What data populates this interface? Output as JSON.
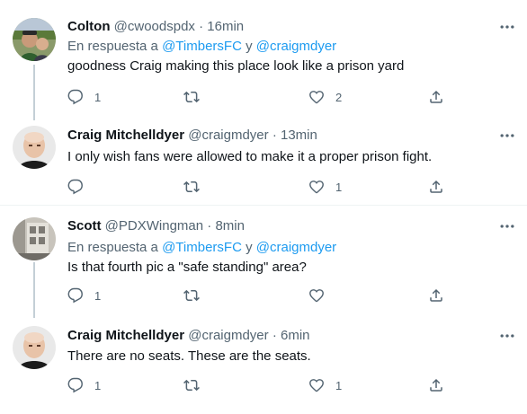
{
  "tweets": [
    {
      "name": "Colton",
      "handle": "@cwoodspdx",
      "dot": "·",
      "time": "16min",
      "reply_prefix": "En respuesta a",
      "mention1": "@TimbersFC",
      "reply_and": "y",
      "mention2": "@craigmdyer",
      "text": "goodness Craig making this place look like a prison yard",
      "reply_count": "1",
      "retweet_count": "",
      "like_count": "2",
      "avatar": "photo-person-outdoors"
    },
    {
      "name": "Craig Mitchelldyer",
      "handle": "@craigmdyer",
      "dot": "·",
      "time": "13min",
      "text": "I only wish fans were allowed to make it a proper prison fight.",
      "reply_count": "",
      "retweet_count": "",
      "like_count": "1",
      "avatar": "photo-bald-man"
    },
    {
      "name": "Scott",
      "handle": "@PDXWingman",
      "dot": "·",
      "time": "8min",
      "reply_prefix": "En respuesta a",
      "mention1": "@TimbersFC",
      "reply_and": "y",
      "mention2": "@craigmdyer",
      "text": "Is that fourth pic a \"safe standing\" area?",
      "reply_count": "1",
      "retweet_count": "",
      "like_count": "",
      "avatar": "photo-building"
    },
    {
      "name": "Craig Mitchelldyer",
      "handle": "@craigmdyer",
      "dot": "·",
      "time": "6min",
      "text": "There are no seats. These are the seats.",
      "reply_count": "1",
      "retweet_count": "",
      "like_count": "1",
      "avatar": "photo-bald-man"
    }
  ],
  "icons": {
    "reply": "reply-icon",
    "retweet": "retweet-icon",
    "like": "heart-icon",
    "share": "share-icon",
    "more": "more-icon"
  },
  "colors": {
    "text": "#0f1419",
    "secondary": "#536471",
    "link": "#1d9bf0",
    "thread_line": "#c4cfd6",
    "divider": "#eff3f4"
  }
}
